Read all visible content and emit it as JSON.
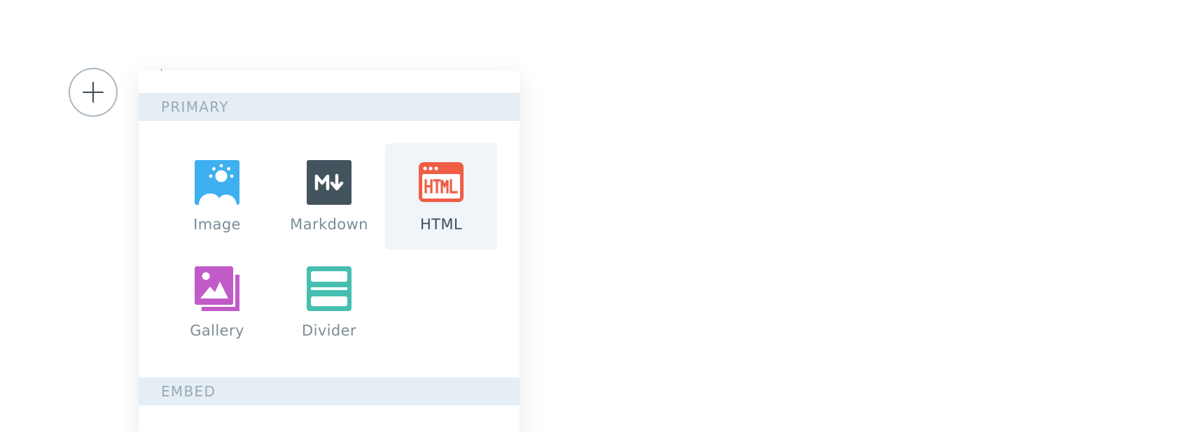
{
  "menu": {
    "sections": [
      {
        "label": "PRIMARY",
        "items": [
          {
            "label": "Image",
            "icon": "image-icon",
            "color": "#3eb0ef"
          },
          {
            "label": "Markdown",
            "icon": "markdown-icon",
            "color": "#44545e"
          },
          {
            "label": "HTML",
            "icon": "html-icon",
            "color": "#ef5d45",
            "active": true
          },
          {
            "label": "Gallery",
            "icon": "gallery-icon",
            "color": "#c15bc8"
          },
          {
            "label": "Divider",
            "icon": "divider-icon",
            "color": "#46bfb0"
          }
        ]
      },
      {
        "label": "EMBED",
        "items": []
      }
    ]
  },
  "add_button": {
    "icon": "plus-icon"
  },
  "colors": {
    "section_bg": "#e5eef5",
    "section_text": "#9aa9b3",
    "active_card_bg": "#f0f5f9",
    "label_text": "#7b8c97",
    "active_label_text": "#3f4c56",
    "plus_border": "#a9b8c1"
  }
}
